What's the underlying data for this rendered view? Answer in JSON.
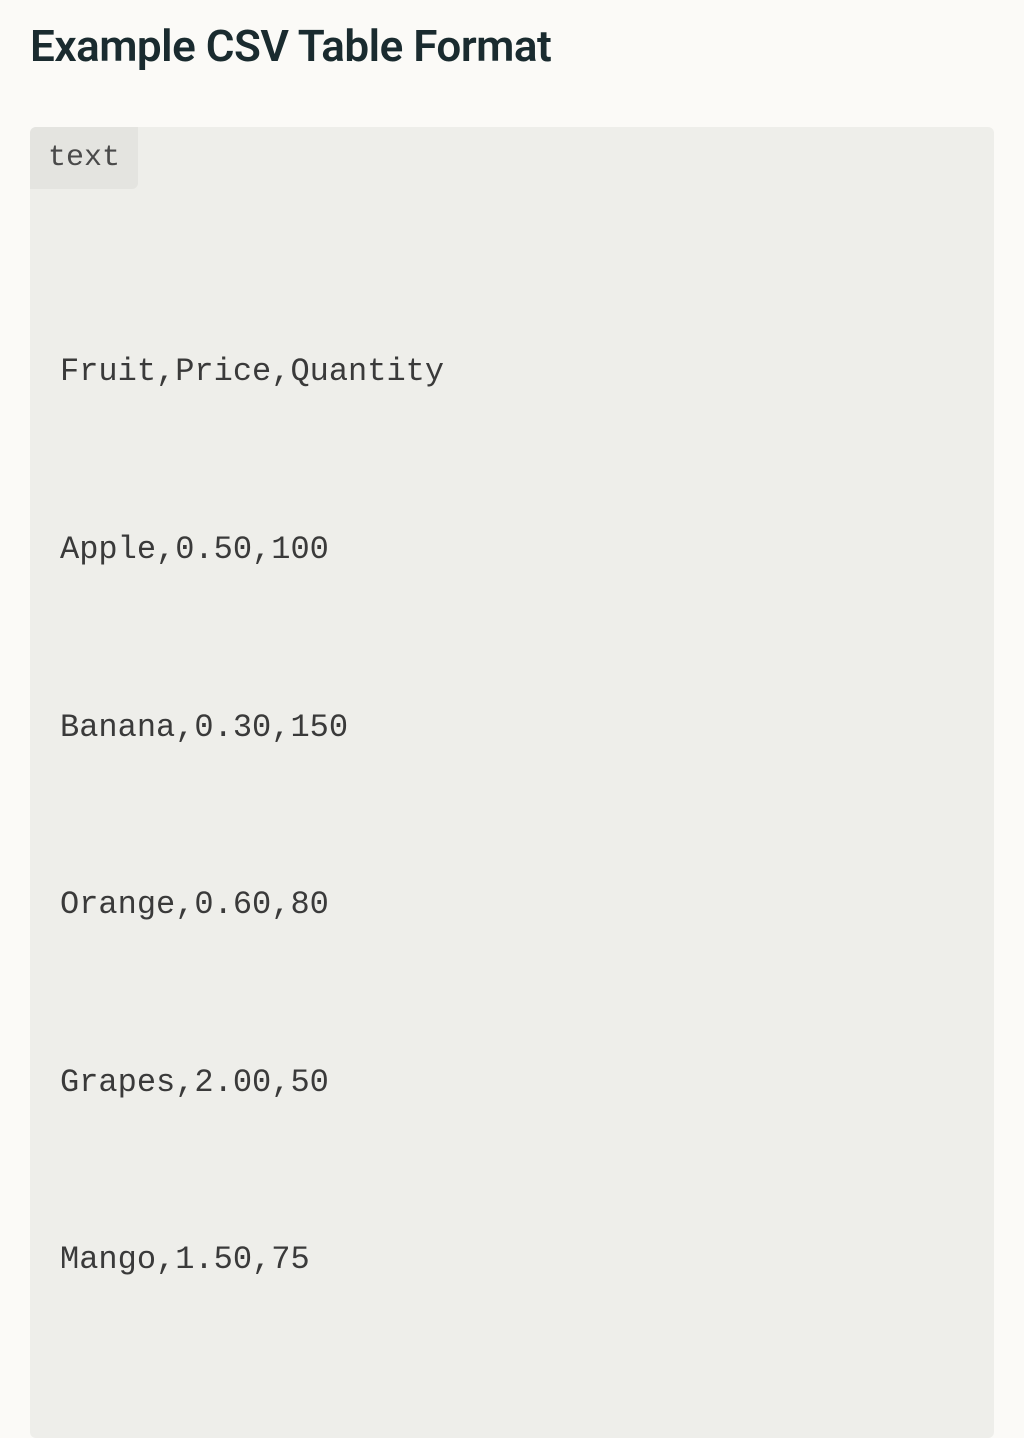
{
  "heading": "Example CSV Table Format",
  "code_block": {
    "language_tag": "text",
    "lines": [
      "Fruit,Price,Quantity",
      "Apple,0.50,100",
      "Banana,0.30,150",
      "Orange,0.60,80",
      "Grapes,2.00,50",
      "Mango,1.50,75"
    ]
  },
  "chart_data": {
    "type": "table",
    "title": "Example CSV Table Format",
    "columns": [
      "Fruit",
      "Price",
      "Quantity"
    ],
    "rows": [
      [
        "Apple",
        0.5,
        100
      ],
      [
        "Banana",
        0.3,
        150
      ],
      [
        "Orange",
        0.6,
        80
      ],
      [
        "Grapes",
        2.0,
        50
      ],
      [
        "Mango",
        1.5,
        75
      ]
    ]
  }
}
